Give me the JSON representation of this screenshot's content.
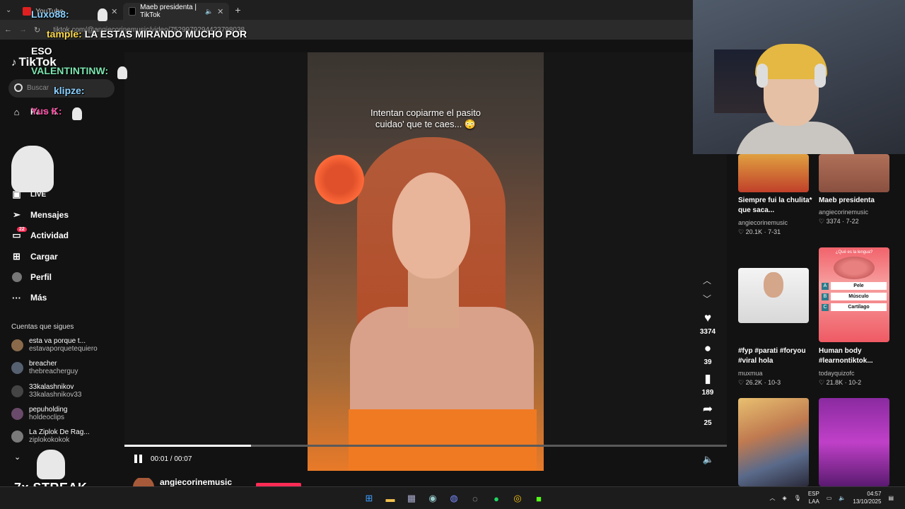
{
  "browser": {
    "tabs": [
      {
        "label": "YouTube",
        "active": false
      },
      {
        "label": "Maeb presidenta | TikTok",
        "active": true
      }
    ],
    "url": "tiktok.com/@angiecorinemusic/video/7529979294423798038"
  },
  "sidebar": {
    "logo": "TikTok",
    "search_placeholder": "Buscar",
    "nav": [
      {
        "label": "Para ti",
        "icon": "home-icon"
      },
      {
        "label": "LIVE",
        "icon": "live-icon"
      },
      {
        "label": "Mensajes",
        "icon": "send-icon"
      },
      {
        "label": "Actividad",
        "icon": "inbox-icon",
        "badge": "22"
      },
      {
        "label": "Cargar",
        "icon": "plus-square-icon"
      },
      {
        "label": "Perfil",
        "icon": "avatar-icon"
      },
      {
        "label": "Más",
        "icon": "more-icon"
      }
    ],
    "following_title": "Cuentas que sigues",
    "following": [
      {
        "name": "esta va porque t...",
        "handle": "estavaporquetequiero"
      },
      {
        "name": "breacher",
        "handle": "thebreacherguy"
      },
      {
        "name": "33kalashnikov",
        "handle": "33kalashnikov33"
      },
      {
        "name": "pepuholding",
        "handle": "holdeoclips"
      },
      {
        "name": "La Ziplok De Rag...",
        "handle": "ziplokokokok"
      }
    ]
  },
  "chat": [
    {
      "user": "Luxo88:",
      "text": ""
    },
    {
      "user": "tample:",
      "text": "LA ESTAS MIRANDO MUCHO POR"
    },
    {
      "user": "",
      "text": "ESO"
    },
    {
      "user": "VALENTINTINW:",
      "text": ""
    },
    {
      "user": "klipze:",
      "text": ""
    },
    {
      "user": "Yus K:",
      "text": ""
    }
  ],
  "streak": "7x STREAK",
  "video": {
    "caption_line1": "Intentan copiarme el pasito",
    "caption_line2": "cuidao' que te caes... 😳",
    "time": "00:01 / 00:07",
    "progress": 0.21,
    "author": "angiecorinemusic",
    "actions": [
      {
        "icon": "heart-icon",
        "count": "3374"
      },
      {
        "icon": "comment-icon",
        "count": "39"
      },
      {
        "icon": "bookmark-icon",
        "count": "189"
      },
      {
        "icon": "share-icon",
        "count": "25"
      }
    ]
  },
  "related": [
    {
      "title": "Siempre fui la chulita* que saca...",
      "author": "angiecorinemusic",
      "likes": "20.1K",
      "date": "7-31"
    },
    {
      "title": "Maeb presidenta",
      "author": "angiecorinemusic",
      "likes": "3374",
      "date": "7-22"
    },
    {
      "title": "#fyp #parati #foryou #viral hola",
      "author": "muxmua",
      "likes": "26.2K",
      "date": "10-3"
    },
    {
      "title": "Human body #learnontiktok...",
      "author": "todayquizofc",
      "likes": "21.8K",
      "date": "10-2"
    }
  ],
  "quiz": {
    "question": "¿Qué es la lengua?",
    "options": [
      {
        "letter": "A",
        "text": "Pele"
      },
      {
        "letter": "B",
        "text": "Músculo"
      },
      {
        "letter": "C",
        "text": "Cartílago"
      }
    ]
  },
  "taskbar": {
    "lang1": "ESP",
    "lang2": "LAA",
    "time": "04:57",
    "date": "13/10/2025"
  },
  "colors": {
    "accent": "#fe2c55",
    "chat_user": "#7ce6b0",
    "quiz_pink": "#ef5a64"
  }
}
